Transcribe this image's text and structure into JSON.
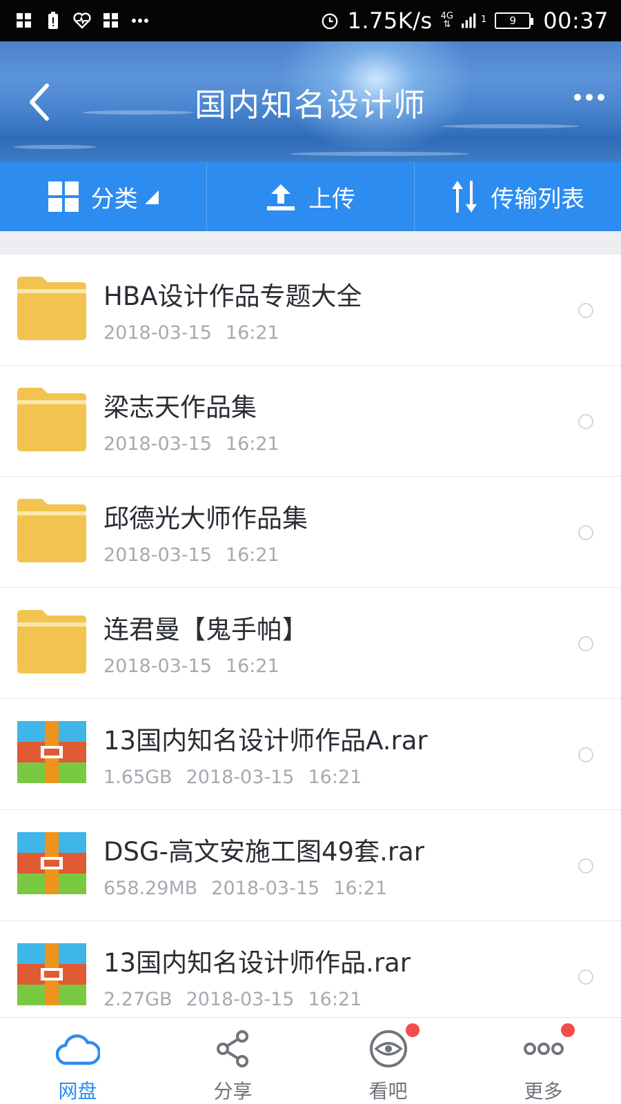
{
  "status_bar": {
    "speed": "1.75K/s",
    "network": "4G",
    "signal_sub": "1",
    "battery": "9",
    "time": "00:37"
  },
  "header": {
    "title": "国内知名设计师"
  },
  "toolbar": {
    "category_label": "分类",
    "upload_label": "上传",
    "transfer_label": "传输列表"
  },
  "files": [
    {
      "type": "folder",
      "name": "HBA设计作品专题大全",
      "size": "",
      "date": "2018-03-15",
      "time": "16:21"
    },
    {
      "type": "folder",
      "name": "梁志天作品集",
      "size": "",
      "date": "2018-03-15",
      "time": "16:21"
    },
    {
      "type": "folder",
      "name": "邱德光大师作品集",
      "size": "",
      "date": "2018-03-15",
      "time": "16:21"
    },
    {
      "type": "folder",
      "name": "连君曼【鬼手帕】",
      "size": "",
      "date": "2018-03-15",
      "time": "16:21"
    },
    {
      "type": "archive",
      "name": "13国内知名设计师作品A.rar",
      "size": "1.65GB",
      "date": "2018-03-15",
      "time": "16:21"
    },
    {
      "type": "archive",
      "name": "DSG-高文安施工图49套.rar",
      "size": "658.29MB",
      "date": "2018-03-15",
      "time": "16:21"
    },
    {
      "type": "archive",
      "name": "13国内知名设计师作品.rar",
      "size": "2.27GB",
      "date": "2018-03-15",
      "time": "16:21"
    }
  ],
  "bottom_nav": {
    "items": [
      {
        "label": "网盘",
        "icon": "cloud-icon",
        "active": true,
        "badge": false
      },
      {
        "label": "分享",
        "icon": "share-icon",
        "active": false,
        "badge": false
      },
      {
        "label": "看吧",
        "icon": "eye-icon",
        "active": false,
        "badge": true
      },
      {
        "label": "更多",
        "icon": "more-dots-icon",
        "active": false,
        "badge": true
      }
    ]
  },
  "colors": {
    "accent": "#2d8cf0",
    "folder": "#f2c44f",
    "badge": "#f24c4c"
  }
}
